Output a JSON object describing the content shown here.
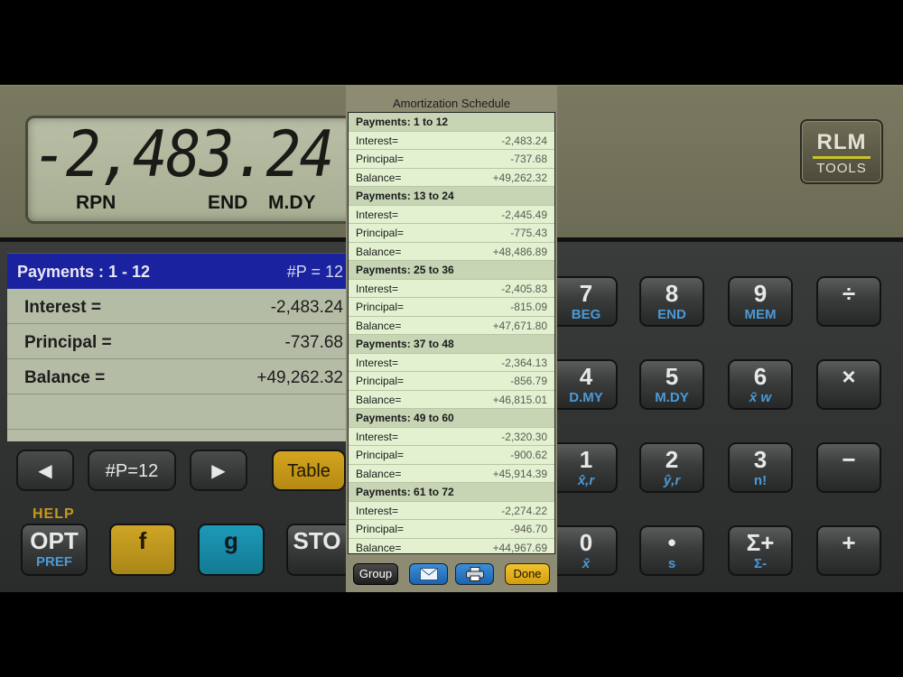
{
  "display": {
    "value": "-2,483.24",
    "annunciators": [
      "RPN",
      "END",
      "M.DY"
    ]
  },
  "brand": {
    "line1": "RLM",
    "line2": "TOOLS"
  },
  "summary_panel": {
    "header_left": "Payments : 1 - 12",
    "header_right": "#P = 12",
    "rows": [
      {
        "label": "Interest =",
        "value": "-2,483.24"
      },
      {
        "label": "Principal =",
        "value": "-737.68"
      },
      {
        "label": "Balance =",
        "value": "+49,262.32"
      }
    ],
    "prev_icon": "◀",
    "period_button": "#P=12",
    "next_icon": "▶",
    "table_button": "Table"
  },
  "function_row": {
    "help_label": "HELP",
    "keys": [
      {
        "main": "OPT",
        "sub": "PREF"
      },
      {
        "main": "f",
        "sub": ""
      },
      {
        "main": "g",
        "sub": ""
      },
      {
        "main": "STO",
        "sub": ""
      }
    ]
  },
  "keypad": [
    {
      "main": "7",
      "sub": "BEG"
    },
    {
      "main": "8",
      "sub": "END"
    },
    {
      "main": "9",
      "sub": "MEM"
    },
    {
      "main": "÷",
      "sub": ""
    },
    {
      "main": "4",
      "sub": "D.MY"
    },
    {
      "main": "5",
      "sub": "M.DY"
    },
    {
      "main": "6",
      "sub": "x̄ w"
    },
    {
      "main": "×",
      "sub": ""
    },
    {
      "main": "1",
      "sub": "x̂,r"
    },
    {
      "main": "2",
      "sub": "ŷ,r"
    },
    {
      "main": "3",
      "sub": "n!"
    },
    {
      "main": "−",
      "sub": ""
    },
    {
      "main": "0",
      "sub": "x̄"
    },
    {
      "main": "•",
      "sub": "s"
    },
    {
      "main": "Σ+",
      "sub": "Σ-"
    },
    {
      "main": "+",
      "sub": ""
    }
  ],
  "schedule": {
    "title": "Amortization Schedule",
    "groups": [
      {
        "header": "Payments: 1 to 12",
        "interest": "-2,483.24",
        "principal": "-737.68",
        "balance": "+49,262.32"
      },
      {
        "header": "Payments: 13 to 24",
        "interest": "-2,445.49",
        "principal": "-775.43",
        "balance": "+48,486.89"
      },
      {
        "header": "Payments: 25 to 36",
        "interest": "-2,405.83",
        "principal": "-815.09",
        "balance": "+47,671.80"
      },
      {
        "header": "Payments: 37 to 48",
        "interest": "-2,364.13",
        "principal": "-856.79",
        "balance": "+46,815.01"
      },
      {
        "header": "Payments: 49 to 60",
        "interest": "-2,320.30",
        "principal": "-900.62",
        "balance": "+45,914.39"
      },
      {
        "header": "Payments: 61 to 72",
        "interest": "-2,274.22",
        "principal": "-946.70",
        "balance": "+44,967.69"
      }
    ],
    "labels": {
      "interest": "Interest=",
      "principal": "Principal=",
      "balance": "Balance="
    },
    "buttons": {
      "group": "Group",
      "email_icon": "envelope-icon",
      "print_icon": "printer-icon",
      "done": "Done"
    }
  },
  "colors": {
    "panel_header": "#1a22a0",
    "accent_yellow": "#d4a420",
    "accent_teal": "#1c9ab8",
    "sub_label_blue": "#4a9ad8",
    "schedule_bg": "#e4f1d0"
  }
}
